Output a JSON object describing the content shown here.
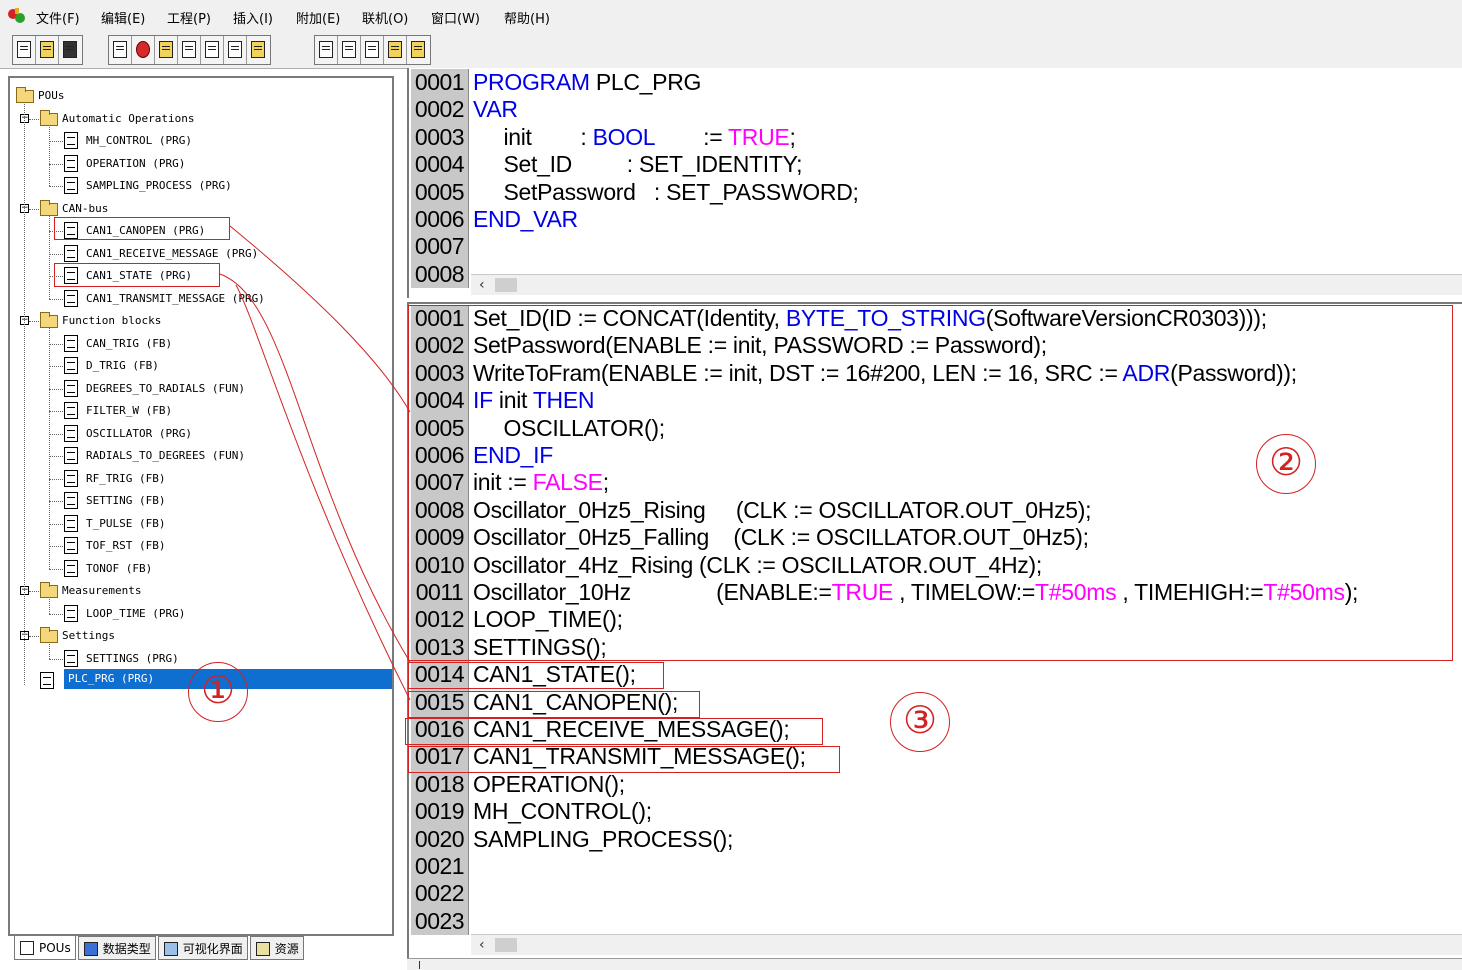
{
  "menu": {
    "items": [
      "文件(F)",
      "编辑(E)",
      "工程(P)",
      "插入(I)",
      "附加(E)",
      "联机(O)",
      "窗口(W)",
      "帮助(H)"
    ]
  },
  "toolbar": {
    "icons": [
      "new-icon",
      "open-icon",
      "save-icon",
      "login-icon",
      "stop-icon",
      "run-icon",
      "step-icon",
      "breakpoint-icon",
      "download-icon",
      "online-icon",
      "cut-icon",
      "copy-icon",
      "paste-icon",
      "find-icon",
      "replace-icon"
    ]
  },
  "tree": {
    "root": "POUs",
    "folders": [
      {
        "label": "Automatic Operations",
        "items": [
          "MH_CONTROL (PRG)",
          "OPERATION (PRG)",
          "SAMPLING_PROCESS (PRG)"
        ]
      },
      {
        "label": "CAN-bus",
        "items": [
          "CAN1_CANOPEN (PRG)",
          "CAN1_RECEIVE_MESSAGE (PRG)",
          "CAN1_STATE (PRG)",
          "CAN1_TRANSMIT_MESSAGE (PRG)"
        ]
      },
      {
        "label": "Function blocks",
        "items": [
          "CAN_TRIG (FB)",
          "D_TRIG (FB)",
          "DEGREES_TO_RADIALS (FUN)",
          "FILTER_W (FB)",
          "OSCILLATOR (PRG)",
          "RADIALS_TO_DEGREES (FUN)",
          "RF_TRIG (FB)",
          "SETTING (FB)",
          "T_PULSE (FB)",
          "TOF_RST (FB)",
          "TONOF (FB)"
        ]
      },
      {
        "label": "Measurements",
        "items": [
          "LOOP_TIME (PRG)"
        ]
      },
      {
        "label": "Settings",
        "items": [
          "SETTINGS (PRG)"
        ]
      }
    ],
    "selected": "PLC_PRG (PRG)"
  },
  "bottom_tabs": [
    "POUs",
    "数据类型",
    "可视化界面",
    "资源"
  ],
  "declaration": {
    "line_numbers": [
      "0001",
      "0002",
      "0003",
      "0004",
      "0005",
      "0006",
      "0007",
      "0008"
    ],
    "lines": [
      [
        {
          "t": "PROGRAM",
          "c": "kw"
        },
        {
          "t": " PLC_PRG"
        }
      ],
      [
        {
          "t": "VAR",
          "c": "kw"
        }
      ],
      [
        {
          "t": "     init        : "
        },
        {
          "t": "BOOL",
          "c": "kw"
        },
        {
          "t": "        := "
        },
        {
          "t": "TRUE",
          "c": "lit"
        },
        {
          "t": ";"
        }
      ],
      [
        {
          "t": "     Set_ID         : SET_IDENTITY;"
        }
      ],
      [
        {
          "t": "     SetPassword   : SET_PASSWORD;"
        }
      ],
      [
        {
          "t": "END_VAR",
          "c": "kw"
        }
      ],
      [
        {
          "t": ""
        }
      ],
      [
        {
          "t": ""
        }
      ]
    ]
  },
  "body": {
    "line_numbers": [
      "0001",
      "0002",
      "0003",
      "0004",
      "0005",
      "0006",
      "0007",
      "0008",
      "0009",
      "0010",
      "0011",
      "0012",
      "0013",
      "0014",
      "0015",
      "0016",
      "0017",
      "0018",
      "0019",
      "0020",
      "0021",
      "0022",
      "0023"
    ],
    "lines": [
      [
        {
          "t": "Set_ID(ID := CONCAT(Identity, "
        },
        {
          "t": "BYTE_TO_STRING",
          "c": "kw"
        },
        {
          "t": "(SoftwareVersionCR0303)));"
        }
      ],
      [
        {
          "t": "SetPassword(ENABLE := init, PASSWORD := Password);"
        }
      ],
      [
        {
          "t": "WriteToFram(ENABLE := init, DST := 16#200, LEN := 16, SRC := "
        },
        {
          "t": "ADR",
          "c": "kw"
        },
        {
          "t": "(Password));"
        }
      ],
      [
        {
          "t": "IF",
          "c": "kw"
        },
        {
          "t": " init "
        },
        {
          "t": "THEN",
          "c": "kw"
        }
      ],
      [
        {
          "t": "     OSCILLATOR();"
        }
      ],
      [
        {
          "t": "END_IF",
          "c": "kw"
        }
      ],
      [
        {
          "t": "init := "
        },
        {
          "t": "FALSE",
          "c": "lit"
        },
        {
          "t": ";"
        }
      ],
      [
        {
          "t": "Oscillator_0Hz5_Rising     (CLK := OSCILLATOR.OUT_0Hz5);"
        }
      ],
      [
        {
          "t": "Oscillator_0Hz5_Falling    (CLK := OSCILLATOR.OUT_0Hz5);"
        }
      ],
      [
        {
          "t": "Oscillator_4Hz_Rising (CLK := OSCILLATOR.OUT_4Hz);"
        }
      ],
      [
        {
          "t": "Oscillator_10Hz              (ENABLE:="
        },
        {
          "t": "TRUE",
          "c": "lit"
        },
        {
          "t": " , TIMELOW:="
        },
        {
          "t": "T#50ms",
          "c": "lit"
        },
        {
          "t": " , TIMEHIGH:="
        },
        {
          "t": "T#50ms",
          "c": "lit"
        },
        {
          "t": ");"
        }
      ],
      [
        {
          "t": "LOOP_TIME();"
        }
      ],
      [
        {
          "t": "SETTINGS();"
        }
      ],
      [
        {
          "t": "CAN1_STATE();"
        }
      ],
      [
        {
          "t": "CAN1_CANOPEN();"
        }
      ],
      [
        {
          "t": "CAN1_RECEIVE_MESSAGE();"
        }
      ],
      [
        {
          "t": "CAN1_TRANSMIT_MESSAGE();"
        }
      ],
      [
        {
          "t": "OPERATION();"
        }
      ],
      [
        {
          "t": "MH_CONTROL();"
        }
      ],
      [
        {
          "t": "SAMPLING_PROCESS();"
        }
      ],
      [
        {
          "t": ""
        }
      ],
      [
        {
          "t": ""
        }
      ],
      [
        {
          "t": ""
        }
      ]
    ]
  },
  "annotations": {
    "labels": [
      "①",
      "②",
      "③"
    ],
    "color": "#d42222"
  },
  "colors": {
    "keyword": "#0000e6",
    "literal": "#ff00ff",
    "selection": "#0e6fd1",
    "line_number_bg": "#c8c8c8"
  }
}
